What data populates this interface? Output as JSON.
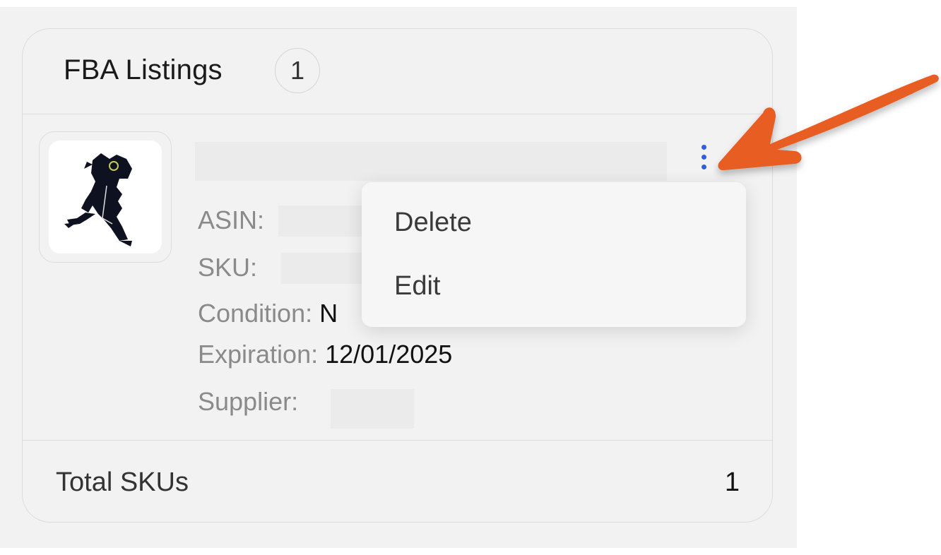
{
  "panel": {
    "title": "FBA Listings",
    "count": "1"
  },
  "listing": {
    "thumbnail_icon": "plush-toy-image",
    "fields": [
      {
        "label": "ASIN:",
        "value": ""
      },
      {
        "label": "SKU:",
        "value": ""
      },
      {
        "label": "Condition:",
        "value": "N"
      },
      {
        "label": "Expiration:",
        "value": "12/01/2025"
      },
      {
        "label": "Supplier:",
        "value": ""
      }
    ],
    "actions_icon": "kebab-menu-icon"
  },
  "menu": {
    "items": [
      {
        "label": "Delete"
      },
      {
        "label": "Edit"
      }
    ]
  },
  "footer": {
    "label": "Total SKUs",
    "value": "1"
  },
  "colors": {
    "accent": "#2f5fde",
    "annotation_arrow": "#e85d22",
    "background": "#f2f2f2"
  }
}
